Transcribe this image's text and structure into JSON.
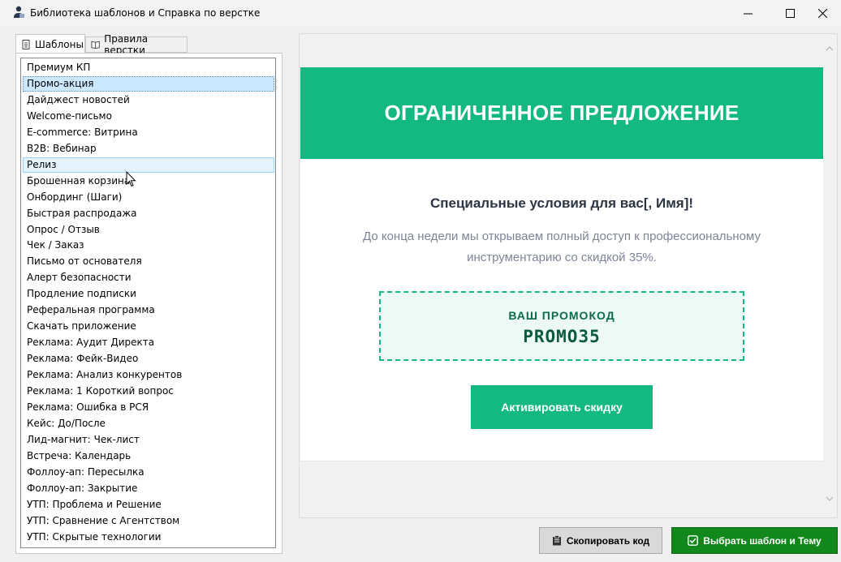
{
  "window": {
    "title": "Библиотека шаблонов и Справка по верстке"
  },
  "tabs": [
    {
      "label": "Шаблоны",
      "icon": "document-icon",
      "active": true
    },
    {
      "label": "Правила верстки",
      "icon": "book-icon",
      "active": false
    }
  ],
  "templates": {
    "selected": "Промо-акция",
    "hovered": "Релиз",
    "items": [
      "Премиум КП",
      "Промо-акция",
      "Дайджест новостей",
      "Welcome-письмо",
      "E-commerce: Витрина",
      "B2B: Вебинар",
      "Релиз",
      "Брошенная корзина",
      "Онбординг (Шаги)",
      "Быстрая распродажа",
      "Опрос / Отзыв",
      "Чек / Заказ",
      "Письмо от основателя",
      "Алерт безопасности",
      "Продление подписки",
      "Реферальная программа",
      "Скачать приложение",
      "Реклама: Аудит Директа",
      "Реклама: Фейк-Видео",
      "Реклама: Анализ конкурентов",
      "Реклама: 1 Короткий вопрос",
      "Реклама: Ошибка в РСЯ",
      "Кейс: До/После",
      "Лид-магнит: Чек-лист",
      "Встреча: Календарь",
      "Фоллоу-ап: Пересылка",
      "Фоллоу-ап: Закрытие",
      "УТП: Проблема и Решение",
      "УТП: Сравнение с Агентством",
      "УТП: Скрытые технологии"
    ]
  },
  "preview": {
    "banner_title": "ОГРАНИЧЕННОЕ ПРЕДЛОЖЕНИЕ",
    "greeting": "Специальные условия для вас[, Имя]!",
    "body_line1": "До конца недели мы открываем полный доступ к профессиональному",
    "body_line2": "инструментарию со скидкой 35%.",
    "promo_label": "ВАШ ПРОМОКОД",
    "promo_code": "PROMO35",
    "cta_label": "Активировать скидку",
    "accent_color": "#14b982"
  },
  "actions": {
    "copy_label": "Скопировать код",
    "copy_icon": "clipboard-icon",
    "select_label": "Выбрать шаблон и Тему",
    "select_icon": "checkbox-icon",
    "select_color": "#12881c"
  }
}
